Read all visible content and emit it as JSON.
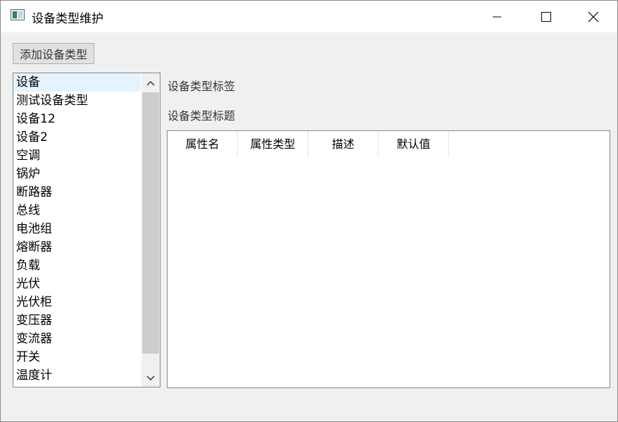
{
  "window": {
    "title": "设备类型维护",
    "icon": "app-window-icon",
    "controls": [
      "minimize-icon",
      "maximize-icon",
      "close-icon"
    ]
  },
  "toolbar": {
    "add_label": "添加设备类型"
  },
  "device_list": {
    "items": [
      {
        "label": "设备",
        "selected": true
      },
      {
        "label": "测试设备类型"
      },
      {
        "label": "设备12"
      },
      {
        "label": "设备2"
      },
      {
        "label": "空调"
      },
      {
        "label": "锅炉"
      },
      {
        "label": "断路器"
      },
      {
        "label": "总线"
      },
      {
        "label": "电池组"
      },
      {
        "label": "熔断器"
      },
      {
        "label": "负载"
      },
      {
        "label": "光伏"
      },
      {
        "label": "光伏柜"
      },
      {
        "label": "变压器"
      },
      {
        "label": "变流器"
      },
      {
        "label": "开关"
      },
      {
        "label": "温度计"
      }
    ]
  },
  "details": {
    "tag_label": "设备类型标签",
    "title_label": "设备类型标题"
  },
  "attributes_table": {
    "columns": [
      "属性名",
      "属性类型",
      "描述",
      "默认值"
    ],
    "rows": []
  },
  "colors": {
    "selected_row": "#e5f3ff",
    "window_bg": "#f0f0f0",
    "scroll_thumb": "#cdcdcd"
  }
}
